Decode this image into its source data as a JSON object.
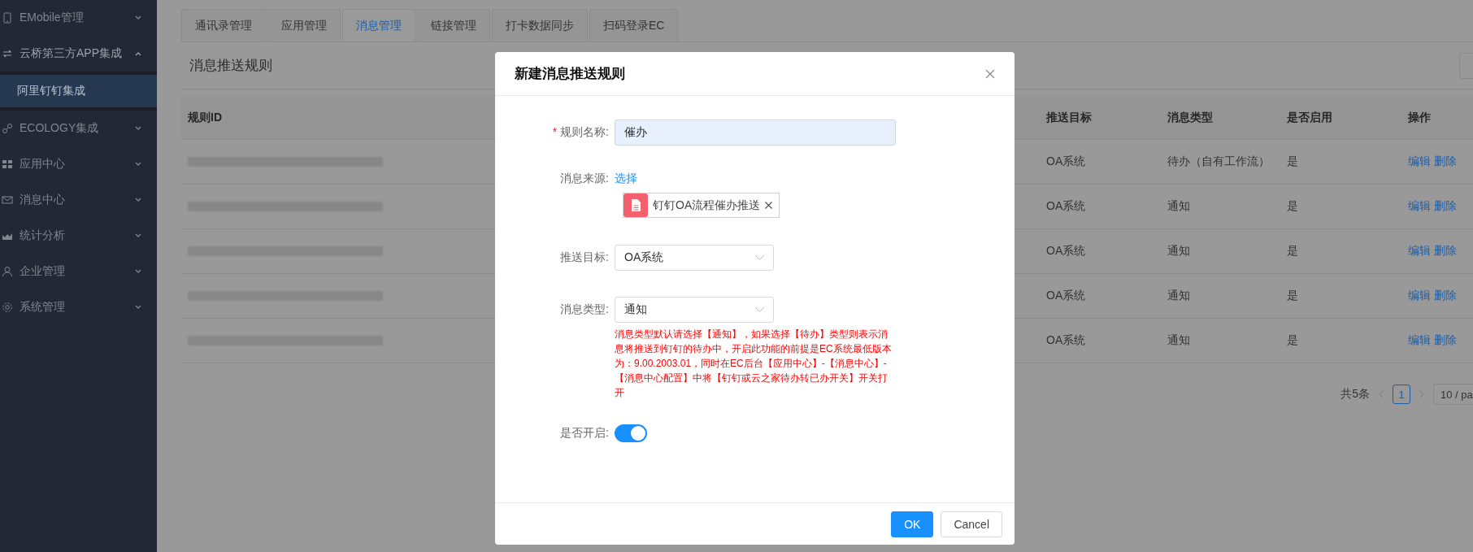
{
  "sidebar": {
    "items": [
      {
        "label": "EMobile管理",
        "expanded": false
      },
      {
        "label": "云桥第三方APP集成",
        "expanded": true,
        "children": [
          {
            "label": "阿里钉钉集成",
            "selected": true
          }
        ]
      },
      {
        "label": "ECOLOGY集成",
        "expanded": false
      },
      {
        "label": "应用中心",
        "expanded": false
      },
      {
        "label": "消息中心",
        "expanded": false
      },
      {
        "label": "统计分析",
        "expanded": false
      },
      {
        "label": "企业管理",
        "expanded": false
      },
      {
        "label": "系统管理",
        "expanded": false
      }
    ]
  },
  "tabs": [
    {
      "label": "通讯录管理",
      "selected": false
    },
    {
      "label": "应用管理",
      "selected": false
    },
    {
      "label": "消息管理",
      "selected": true
    },
    {
      "label": "链接管理",
      "selected": false
    },
    {
      "label": "打卡数据同步",
      "selected": false
    },
    {
      "label": "扫码登录EC",
      "selected": false
    }
  ],
  "page_title": "消息推送规则",
  "table": {
    "columns": [
      "规则ID",
      "推送目标",
      "消息类型",
      "是否启用",
      "操作"
    ],
    "rows": [
      {
        "target": "OA系统",
        "type": "待办（自有工作流）",
        "enabled": "是",
        "actions": [
          "编辑",
          "删除"
        ]
      },
      {
        "target": "OA系统",
        "type": "通知",
        "enabled": "是",
        "actions": [
          "编辑",
          "删除"
        ]
      },
      {
        "target": "OA系统",
        "type": "通知",
        "enabled": "是",
        "actions": [
          "编辑",
          "删除"
        ]
      },
      {
        "target": "OA系统",
        "type": "通知",
        "enabled": "是",
        "actions": [
          "编辑",
          "删除"
        ]
      },
      {
        "target": "OA系统",
        "type": "通知",
        "enabled": "是",
        "actions": [
          "编辑",
          "删除"
        ]
      }
    ]
  },
  "pagination": {
    "total": "共5条",
    "pages": [
      {
        "label": "1",
        "selected": true
      }
    ],
    "page_size": "10 / pa"
  },
  "dialog": {
    "title": "新建消息推送规则",
    "fields": [
      {
        "kind": "text",
        "label": "规则名称:",
        "required_mark": "*",
        "value": "催办"
      },
      {
        "kind": "source",
        "label": "消息来源:",
        "link": "选择",
        "tag": "钉钉OA流程催办推送"
      },
      {
        "kind": "select",
        "label": "推送目标:",
        "value": "OA系统"
      },
      {
        "kind": "select",
        "label": "消息类型:",
        "value": "通知",
        "note": "消息类型默认请选择【通知】，如果选择【待办】类型则表示消息将推送到钉钉的待办中，开启此功能的前提是EC系统最低版本为：9.00.2003.01，同时在EC后台【应用中心】-【消息中心】-【消息中心配置】中将【钉钉或云之家待办转已办开关】开关打开"
      },
      {
        "kind": "switch",
        "label": "是否开启:",
        "on": true
      }
    ],
    "buttons": [
      {
        "label": "OK",
        "kind": "primary"
      },
      {
        "label": "Cancel",
        "kind": "default"
      }
    ]
  }
}
